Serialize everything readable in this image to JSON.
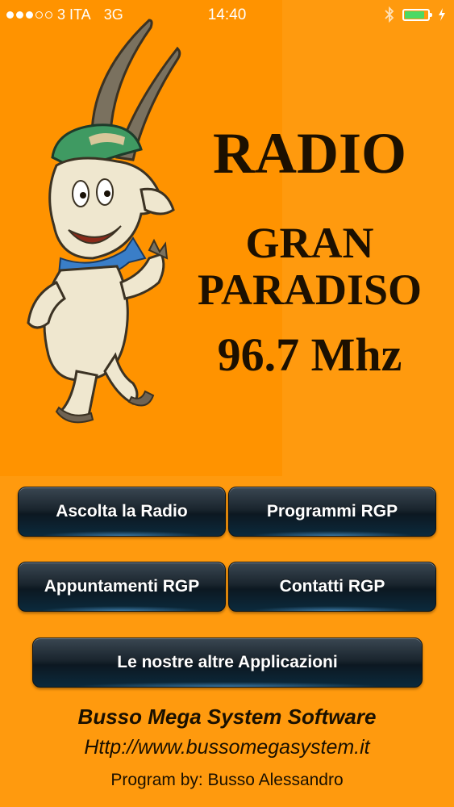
{
  "status_bar": {
    "signal_bars_filled": 3,
    "signal_bars_total": 5,
    "carrier": "3 ITA",
    "network": "3G",
    "time": "14:40",
    "bluetooth_icon": "bluetooth-icon",
    "battery_level": 0.85,
    "charging_icon": "bolt-icon"
  },
  "banner": {
    "mascot_icon": "goat-mascot",
    "radio_title": "RADIO",
    "station_line1": "GRAN",
    "station_line2": "PARADISO",
    "frequency": "96.7 Mhz"
  },
  "buttons": {
    "listen": "Ascolta la Radio",
    "programs": "Programmi RGP",
    "appointments": "Appuntamenti RGP",
    "contacts": "Contatti RGP",
    "other_apps": "Le nostre altre Applicazioni"
  },
  "footer": {
    "company": "Busso Mega System Software",
    "website": "Http://www.bussomegasystem.it",
    "author": "Program by: Busso Alessandro"
  },
  "colors": {
    "background": "#ff9a0e",
    "banner": "#ff9300",
    "button_dark": "#0c1821",
    "text_dark": "#1c1000"
  }
}
